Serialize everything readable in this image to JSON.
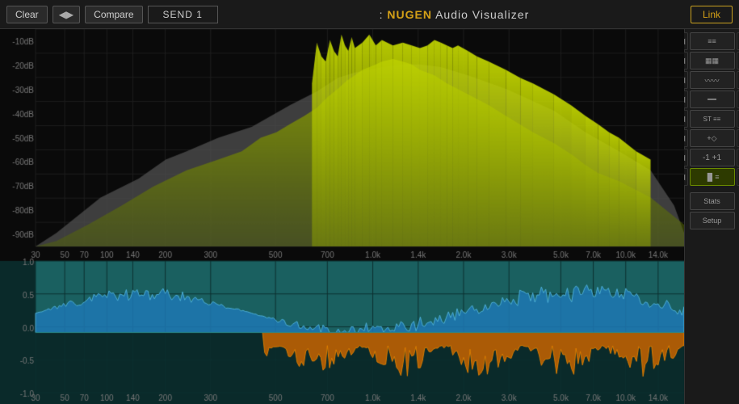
{
  "header": {
    "clear_label": "Clear",
    "compare_label": "Compare",
    "send_label": "SEND 1",
    "title_prefix": ":",
    "title_nugen": " NUGEN",
    "title_audio": " Audio",
    "title_viz": " Visualizer",
    "link_label": "Link"
  },
  "spectrum": {
    "db_labels": [
      "-10dB",
      "-20dB",
      "-30dB",
      "-40dB",
      "-50dB",
      "-60dB",
      "-70dB",
      "-80dB",
      "-90dB"
    ],
    "amp_labels": [
      "1.0",
      "0.5",
      "0.0",
      "-0.5",
      "-1.0"
    ],
    "freq_labels": [
      {
        "val": "30",
        "pos": 0
      },
      {
        "val": "50",
        "pos": 4.5
      },
      {
        "val": "70",
        "pos": 7.5
      },
      {
        "val": "100",
        "pos": 11
      },
      {
        "val": "140",
        "pos": 15
      },
      {
        "val": "200",
        "pos": 20
      },
      {
        "val": "300",
        "pos": 27
      },
      {
        "val": "500",
        "pos": 37
      },
      {
        "val": "700",
        "pos": 45
      },
      {
        "val": "1.0k",
        "pos": 52
      },
      {
        "val": "1.4k",
        "pos": 59
      },
      {
        "val": "2.0k",
        "pos": 66
      },
      {
        "val": "3.0k",
        "pos": 73
      },
      {
        "val": "5.0k",
        "pos": 81
      },
      {
        "val": "7.0k",
        "pos": 86
      },
      {
        "val": "10.0k",
        "pos": 91
      },
      {
        "val": "14.0k",
        "pos": 96
      }
    ]
  },
  "sidebar": {
    "buttons": [
      {
        "id": "bars-btn",
        "icon": "≡≡",
        "label": ""
      },
      {
        "id": "spectrum-btn",
        "icon": "▦▦",
        "label": ""
      },
      {
        "id": "wave-btn",
        "icon": "~~~",
        "label": ""
      },
      {
        "id": "lines-btn",
        "icon": "---",
        "label": ""
      },
      {
        "id": "st-btn",
        "icon": "ST",
        "label": ""
      },
      {
        "id": "diamond-btn",
        "icon": "◆",
        "label": ""
      },
      {
        "id": "minus1-btn",
        "icon": "-1",
        "label": ""
      },
      {
        "id": "plus1-btn",
        "icon": "+1",
        "label": ""
      },
      {
        "id": "meter-btn",
        "icon": "▐▌",
        "label": ""
      },
      {
        "id": "stats-btn",
        "label": "Stats"
      },
      {
        "id": "setup-btn",
        "label": "Setup"
      }
    ]
  }
}
